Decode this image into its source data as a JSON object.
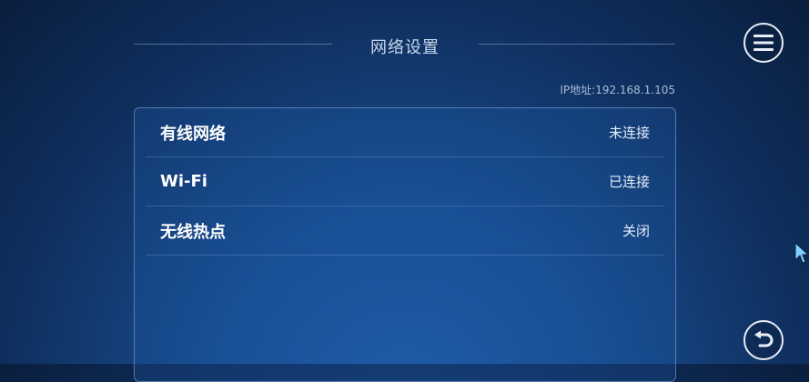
{
  "header": {
    "title": "网络设置",
    "ip_text": "IP地址:192.168.1.105"
  },
  "network_items": [
    {
      "label": "有线网络",
      "status": "未连接"
    },
    {
      "label": "Wi-Fi",
      "status": "已连接"
    },
    {
      "label": "无线热点",
      "status": "关闭"
    }
  ],
  "icons": {
    "menu": "hamburger-menu-icon",
    "back": "back-arrow-icon",
    "cursor": "mouse-pointer-icon"
  },
  "colors": {
    "background_top": "#0a1e3d",
    "background_bottom": "#1f5ea8",
    "text": "#ffffff",
    "muted_text": "#a9bcd6"
  }
}
